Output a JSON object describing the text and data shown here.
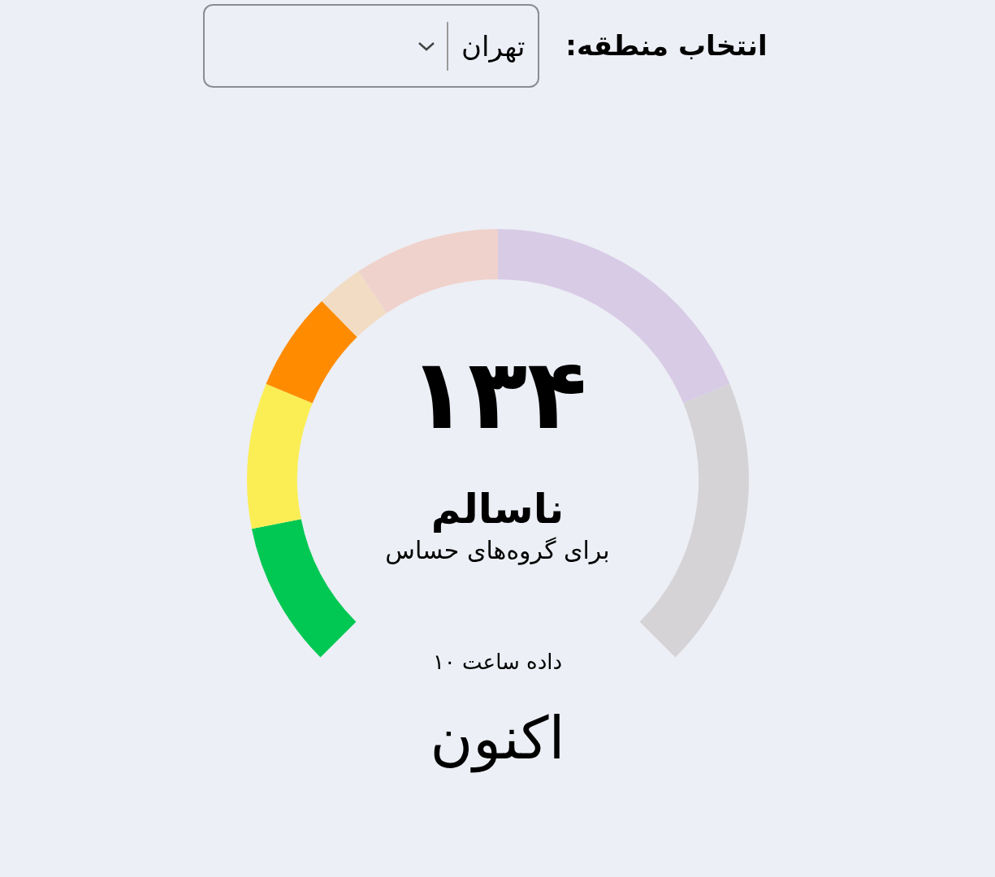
{
  "region": {
    "label": "انتخاب منطقه:",
    "value": "تهران"
  },
  "gauge": {
    "value": "۱۳۴",
    "category": "ناسالم",
    "subtitle": "برای گروه‌های حساس",
    "segments": [
      {
        "color": "#00c853"
      },
      {
        "color": "#fbee55"
      },
      {
        "color": "#ff8c00"
      },
      {
        "color": "#f2dcc4"
      },
      {
        "color": "#f0d2cc"
      },
      {
        "color": "#d8cbe6"
      },
      {
        "color": "#d5d3d6"
      }
    ]
  },
  "time_note": "داده ساعت ۱۰",
  "period": "اکنون"
}
